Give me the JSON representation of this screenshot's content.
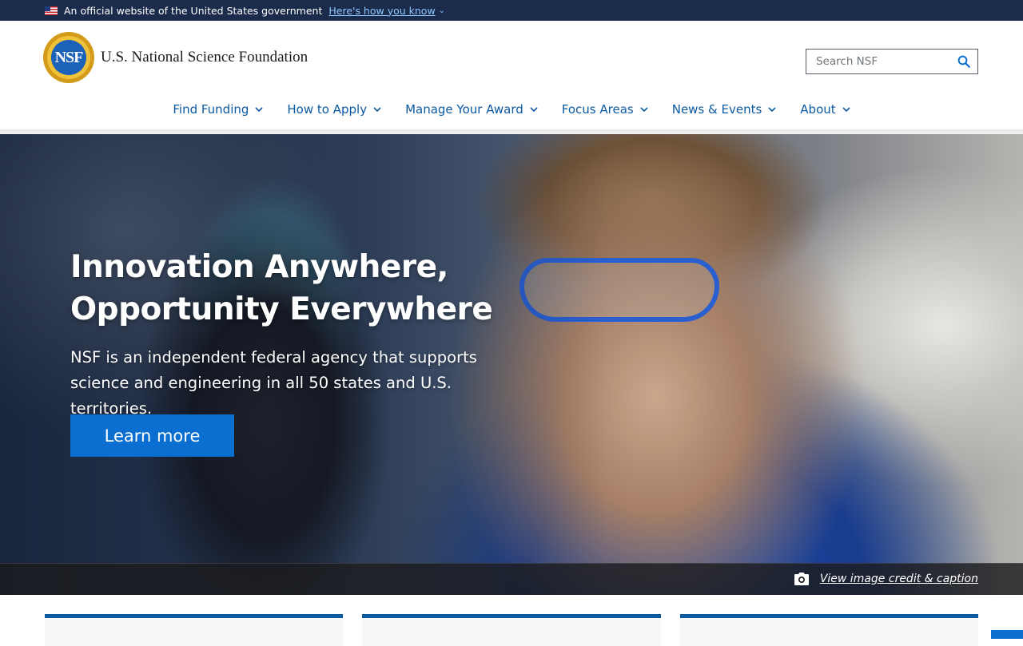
{
  "gov_banner": {
    "text": "An official website of the United States government",
    "link": "Here's how you know"
  },
  "header": {
    "seal_text": "NSF",
    "org_name": "U.S. National Science Foundation",
    "search_placeholder": "Search NSF"
  },
  "nav": {
    "items": [
      {
        "label": "Find Funding"
      },
      {
        "label": "How to Apply"
      },
      {
        "label": "Manage Your Award"
      },
      {
        "label": "Focus Areas"
      },
      {
        "label": "News & Events"
      },
      {
        "label": "About"
      }
    ]
  },
  "hero": {
    "title_line1": "Innovation Anywhere,",
    "title_line2": "Opportunity Everywhere",
    "desc_line1": "NSF is an independent federal agency that supports",
    "desc_line2": "science and engineering in all 50 states and U.S. territories.",
    "button_label": "Learn more",
    "credit_link": "View image credit & caption"
  },
  "colors": {
    "banner_bg": "#1b2b4b",
    "link_blue": "#0b5aa2",
    "button_blue": "#0a6fd1"
  }
}
